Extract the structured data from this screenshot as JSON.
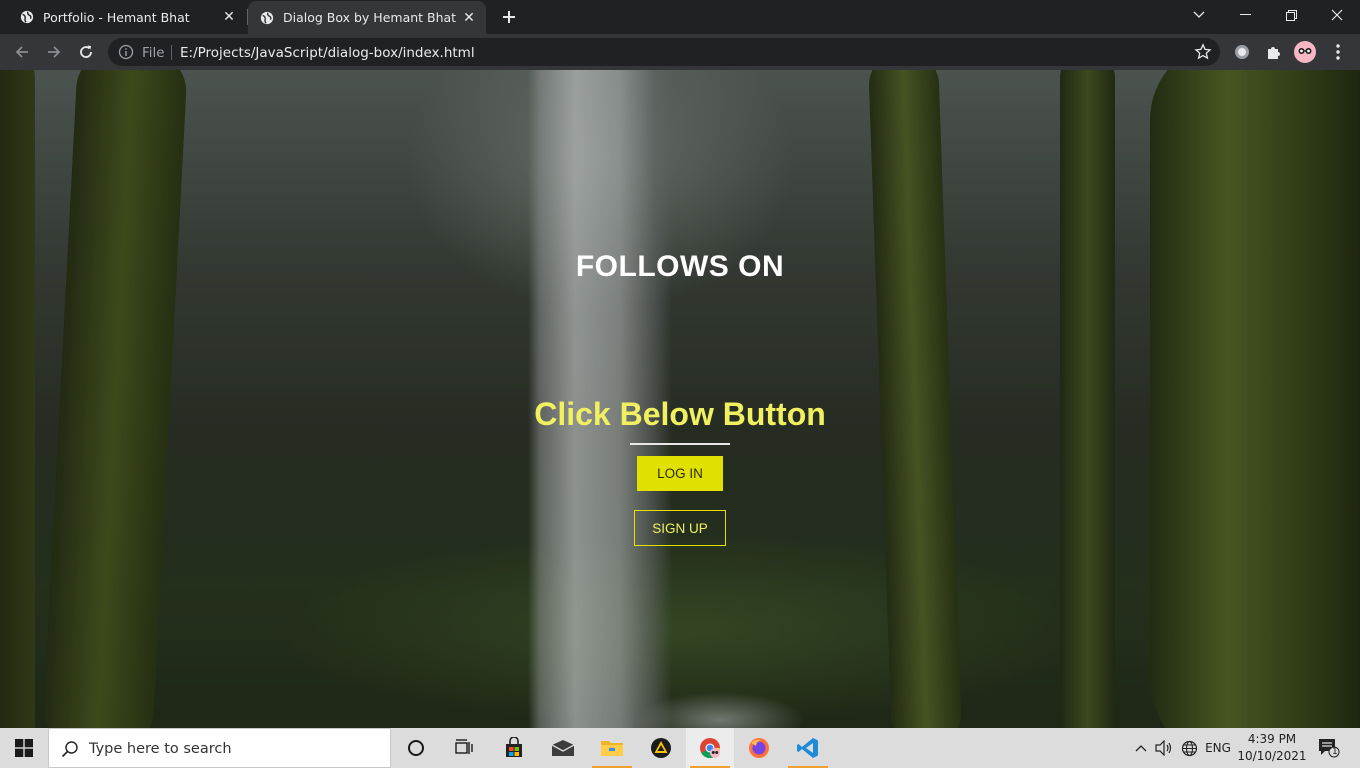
{
  "browser": {
    "tabs": [
      {
        "title": "Portfolio - Hemant Bhat",
        "active": false
      },
      {
        "title": "Dialog Box by Hemant Bhat",
        "active": true
      }
    ],
    "omnibox": {
      "scheme_label": "File",
      "url": "E:/Projects/JavaScript/dialog-box/index.html"
    }
  },
  "page": {
    "heading": "FOLLOWS ON",
    "subheading": "Click Below Button",
    "login_label": "LOG IN",
    "signup_label": "SIGN UP"
  },
  "taskbar": {
    "search_placeholder": "Type here to search",
    "language": "ENG",
    "time": "4:39 PM",
    "date": "10/10/2021",
    "notification_count": "1"
  },
  "colors": {
    "accent_yellow": "#e1e100",
    "heading_yellow": "#f0f060",
    "browser_dark": "#202124",
    "toolbar": "#35363a"
  },
  "icons": {
    "tab_favicon": "globe-icon",
    "new_tab": "plus-icon",
    "back": "arrow-left-icon",
    "forward": "arrow-right-icon",
    "reload": "reload-icon",
    "site_info": "info-icon",
    "bookmark": "star-icon",
    "extensions": "puzzle-icon",
    "profile": "avatar-icon",
    "menu": "kebab-menu-icon"
  }
}
